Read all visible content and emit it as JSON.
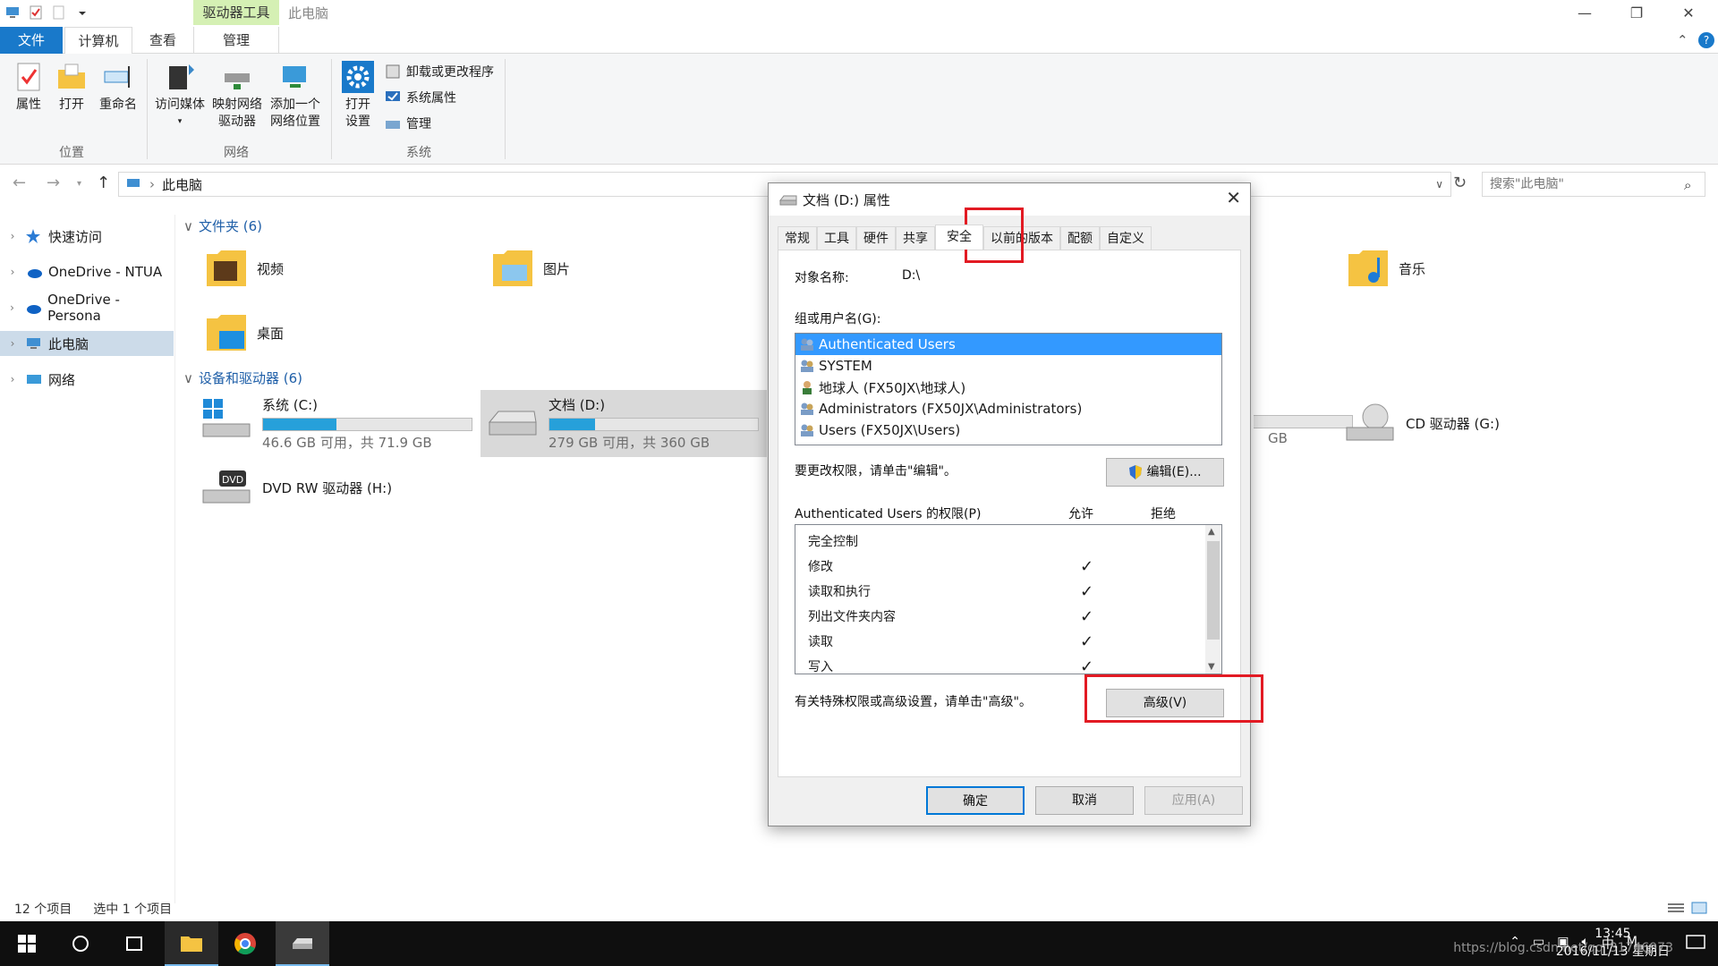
{
  "window": {
    "title": "此电脑",
    "context_tab": "驱动器工具"
  },
  "menu_tabs": {
    "file": "文件",
    "computer": "计算机",
    "view": "查看",
    "manage": "管理"
  },
  "ribbon": {
    "location_group": "位置",
    "network_group": "网络",
    "system_group": "系统",
    "properties": "属性",
    "open": "打开",
    "rename": "重命名",
    "access_media": "访问媒体",
    "map_drive_1": "映射网络",
    "map_drive_2": "驱动器",
    "add_network_1": "添加一个",
    "add_network_2": "网络位置",
    "open_settings_1": "打开",
    "open_settings_2": "设置",
    "uninstall": "卸载或更改程序",
    "system_props": "系统属性",
    "manage": "管理"
  },
  "address": {
    "path": "此电脑",
    "search_placeholder": "搜索\"此电脑\""
  },
  "nav": {
    "quick_access": "快速访问",
    "onedrive_ntua": "OneDrive - NTUA",
    "onedrive_personal": "OneDrive - Persona",
    "this_pc": "此电脑",
    "network": "网络"
  },
  "folders_header": "文件夹 (6)",
  "folders": {
    "videos": "视频",
    "pictures": "图片",
    "music": "音乐",
    "desktop": "桌面"
  },
  "drives_header": "设备和驱动器 (6)",
  "drives": {
    "c": {
      "name": "系统 (C:)",
      "free": "46.6 GB 可用，共 71.9 GB",
      "used_fraction": 0.35
    },
    "d": {
      "name": "文档 (D:)",
      "free": "279 GB 可用，共 360 GB",
      "used_fraction": 0.22
    },
    "hidden": {
      "free": "GB"
    },
    "g": {
      "name": "CD 驱动器 (G:)"
    },
    "h": {
      "name": "DVD RW 驱动器 (H:)"
    }
  },
  "status": {
    "items": "12 个项目",
    "selected": "选中 1 个项目"
  },
  "dialog": {
    "title": "文档 (D:) 属性",
    "tabs": [
      "常规",
      "工具",
      "硬件",
      "共享",
      "安全",
      "以前的版本",
      "配额",
      "自定义"
    ],
    "object_label": "对象名称:",
    "object_value": "D:\\",
    "groups_label": "组或用户名(G):",
    "users": [
      "Authenticated Users",
      "SYSTEM",
      "地球人 (FX50JX\\地球人)",
      "Administrators (FX50JX\\Administrators)",
      "Users (FX50JX\\Users)"
    ],
    "edit_hint": "要更改权限，请单击\"编辑\"。",
    "edit_button": "编辑(E)...",
    "perm_label": "Authenticated Users 的权限(P)",
    "allow": "允许",
    "deny": "拒绝",
    "perms": [
      {
        "name": "完全控制",
        "allow": ""
      },
      {
        "name": "修改",
        "allow": "✓"
      },
      {
        "name": "读取和执行",
        "allow": "✓"
      },
      {
        "name": "列出文件夹内容",
        "allow": "✓"
      },
      {
        "name": "读取",
        "allow": "✓"
      },
      {
        "name": "写入",
        "allow": "✓"
      }
    ],
    "advanced_hint": "有关特殊权限或高级设置，请单击\"高级\"。",
    "advanced_button": "高级(V)",
    "ok": "确定",
    "cancel": "取消",
    "apply": "应用(A)"
  },
  "taskbar": {
    "time": "13:45",
    "date": "2016/11/13 星期日",
    "ime": "中",
    "ime2": "M"
  },
  "watermark": "https://blog.csdn.net/qq_31746973",
  "colors": {
    "accent": "#1979ca",
    "selection": "#3399ff",
    "highlight_box": "#e21a23",
    "progress": "#26a0da"
  }
}
